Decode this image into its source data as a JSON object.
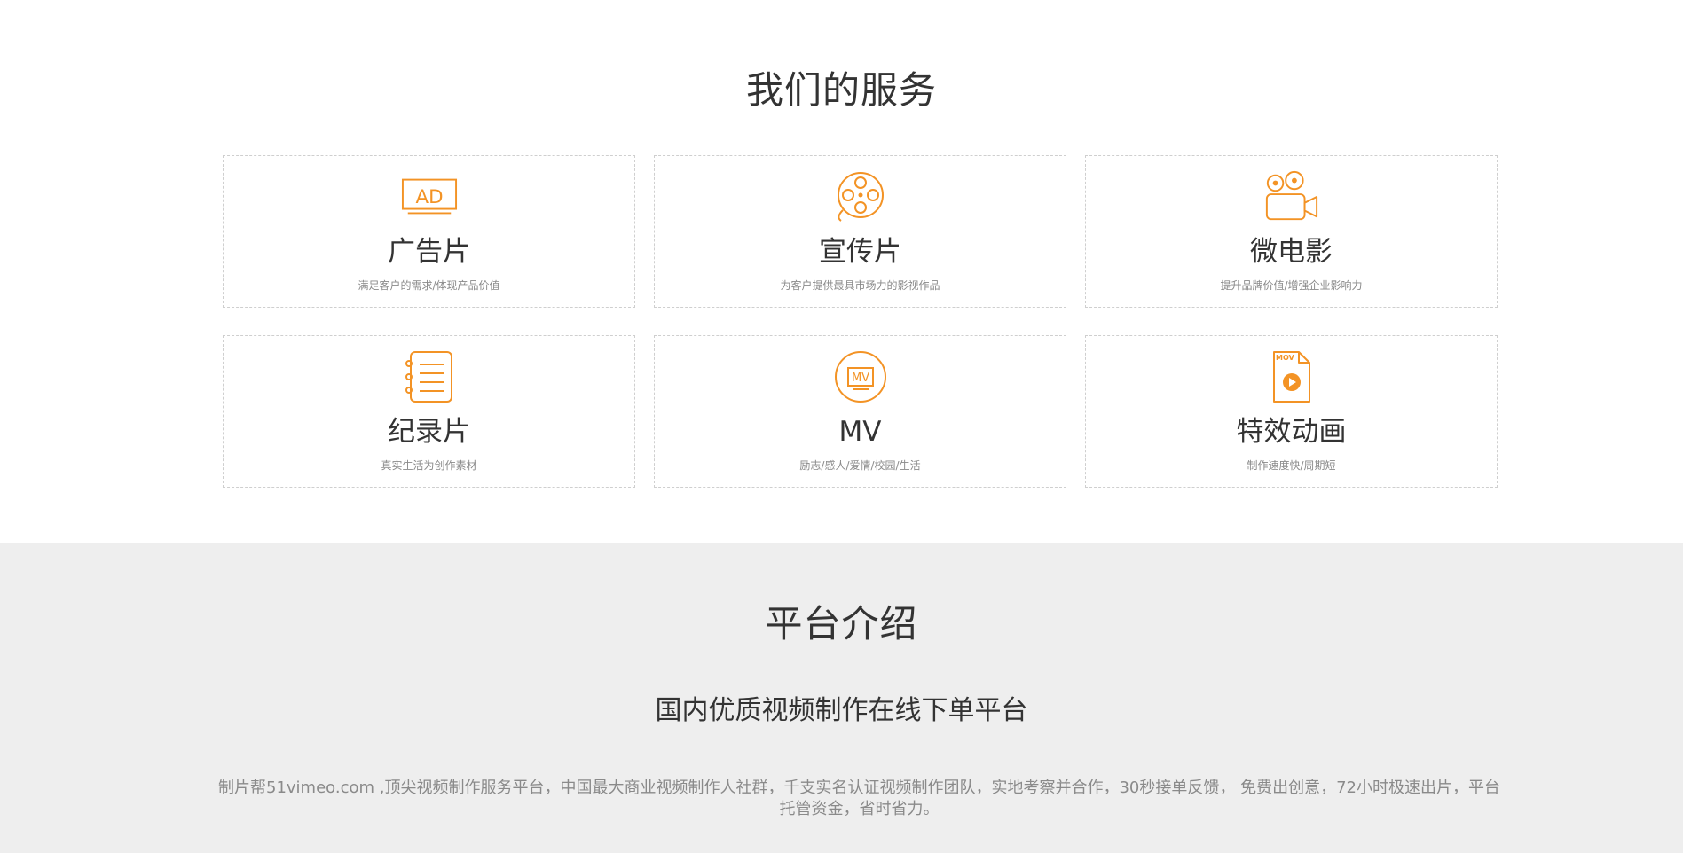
{
  "services": {
    "title": "我们的服务",
    "accent_color": "#f39325",
    "cards": [
      {
        "name": "广告片",
        "desc": "满足客户的需求/体现产品价值",
        "icon": "ad-icon"
      },
      {
        "name": "宣传片",
        "desc": "为客户提供最具市场力的影视作品",
        "icon": "film-reel-icon"
      },
      {
        "name": "微电影",
        "desc": "提升品牌价值/增强企业影响力",
        "icon": "movie-camera-icon"
      },
      {
        "name": "纪录片",
        "desc": "真实生活为创作素材",
        "icon": "notebook-icon"
      },
      {
        "name": "MV",
        "desc": "励志/感人/爱情/校园/生活",
        "icon": "mv-icon"
      },
      {
        "name": "特效动画",
        "desc": "制作速度快/周期短",
        "icon": "mov-file-icon"
      }
    ]
  },
  "platform": {
    "title": "平台介绍",
    "subtitle": "国内优质视频制作在线下单平台",
    "body": "制片帮51vimeo.com ,顶尖视频制作服务平台，中国最大商业视频制作人社群，千支实名认证视频制作团队，实地考察并合作，30秒接单反馈， 免费出创意，72小时极速出片，平台托管资金，省时省力。"
  }
}
